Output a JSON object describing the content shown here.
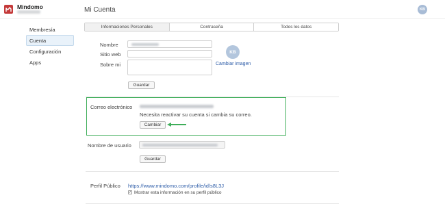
{
  "app": {
    "brand": "Mindomo",
    "page_title": "Mi Cuenta",
    "user_initials": "KB"
  },
  "sidebar": {
    "items": [
      {
        "label": "Membresía",
        "active": false
      },
      {
        "label": "Cuenta",
        "active": true
      },
      {
        "label": "Configuración",
        "active": false
      },
      {
        "label": "Apps",
        "active": false
      }
    ]
  },
  "tabs": [
    {
      "label": "Informaciones Personales",
      "active": true
    },
    {
      "label": "Contraseña",
      "active": false
    },
    {
      "label": "Todos los datos",
      "active": false
    }
  ],
  "profile": {
    "name_label": "Nombre",
    "website_label": "Sitio web",
    "about_label": "Sobre mi",
    "avatar_initials": "KB",
    "change_image": "Cambiar imagen",
    "save_label": "Guardar"
  },
  "email": {
    "label": "Correo electrónico",
    "notice": "Necesita reactivar su cuenta si cambia su correo.",
    "change_label": "Cambiar"
  },
  "username": {
    "label": "Nombre de usuario",
    "save_label": "Guardar"
  },
  "public_profile": {
    "label": "Perfil Público",
    "url": "https://www.mindomo.com/profile/id/s8L3J",
    "checkbox_label": "Mostrar esta información en su perfil público",
    "checked": true
  },
  "colors": {
    "brand": "#c43a3a",
    "highlight": "#3fae5a",
    "link": "#2b5ba7"
  }
}
